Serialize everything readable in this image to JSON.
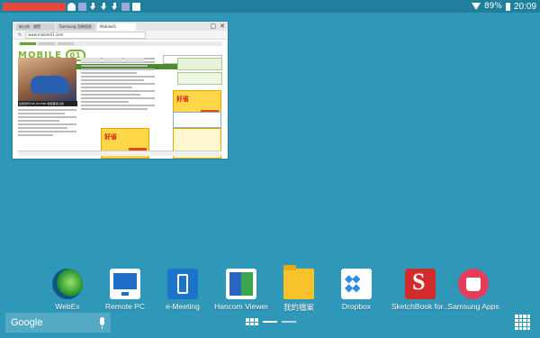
{
  "status_bar": {
    "left_icons": [
      "cloud-icon",
      "cloud-icon",
      "cloud-icon",
      "cloud-icon",
      "cloud-icon",
      "cloud-icon",
      "cloud-icon",
      "app-notification-icon",
      "app-notification-icon",
      "download-icon",
      "download-icon",
      "download-icon",
      "photo-icon",
      "camera-icon"
    ],
    "battery_percent": "89%",
    "clock": "20:09"
  },
  "browser_thumbnail": {
    "tabs": [
      "新分頁 - 瀏覽",
      "Samsung 官網首頁",
      "Mobile01"
    ],
    "url": "www.mobile01.com",
    "site_logo": "MOBILE",
    "site_logo_suffix": "01",
    "hero_caption": "全新世代TGS STV380 地球首試公開",
    "promo_sale_text": "好省",
    "close_glyph": "✕",
    "refresh_glyph": "↻"
  },
  "dock": {
    "apps": [
      {
        "label": "WebEx",
        "icon": "webex-icon"
      },
      {
        "label": "Remote PC",
        "icon": "remote-pc-icon"
      },
      {
        "label": "e-Meeting",
        "icon": "e-meeting-icon"
      },
      {
        "label": "Hancom Viewer",
        "icon": "hancom-viewer-icon"
      },
      {
        "label": "我的檔案",
        "icon": "my-files-icon"
      },
      {
        "label": "Dropbox",
        "icon": "dropbox-icon"
      },
      {
        "label": "SketchBook for...",
        "icon": "sketchbook-icon"
      },
      {
        "label": "Samsung Apps",
        "icon": "samsung-apps-icon"
      }
    ]
  },
  "bottom_bar": {
    "search_logo": "Google",
    "pages": 3,
    "current_page": 2
  },
  "colors": {
    "wallpaper": "#2f97b8",
    "status_bar": "#1f7f9c",
    "site_green": "#7fb332"
  }
}
